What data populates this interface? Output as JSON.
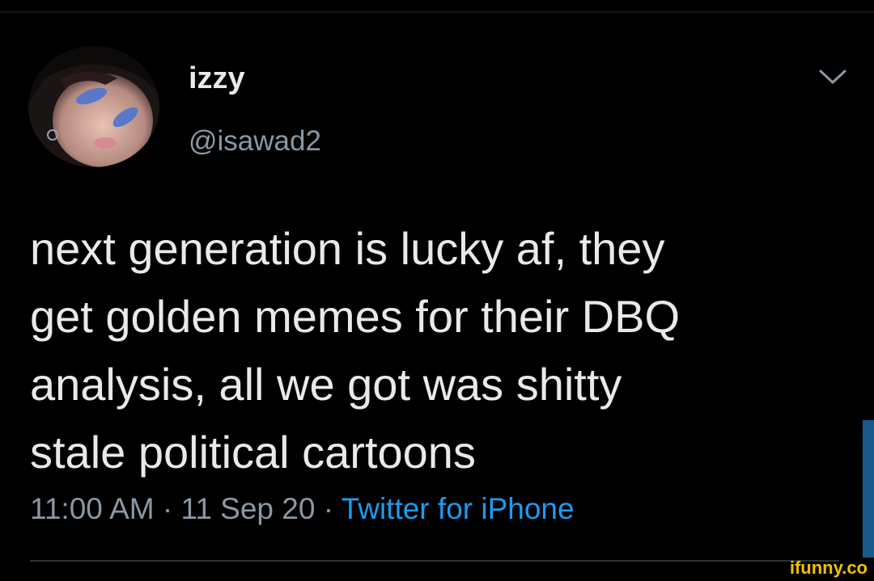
{
  "author": {
    "display_name": "izzy",
    "handle": "@isawad2",
    "avatar_icon": "profile-photo-avatar"
  },
  "tweet": {
    "lines": [
      "next generation is lucky af, they",
      "get golden memes for their DBQ",
      "analysis, all we got was shitty",
      "stale political cartoons"
    ],
    "time": "11:00 AM",
    "separator": " · ",
    "date": "11 Sep 20",
    "source": "Twitter for iPhone"
  },
  "controls": {
    "more_icon": "chevron-down-icon"
  },
  "watermark": {
    "text": "ifunny.co"
  },
  "colors": {
    "background": "#000000",
    "primary_text": "#e7e9ea",
    "secondary_text": "#8b98a5",
    "link": "#1d9bf0",
    "watermark": "#f2c200"
  }
}
